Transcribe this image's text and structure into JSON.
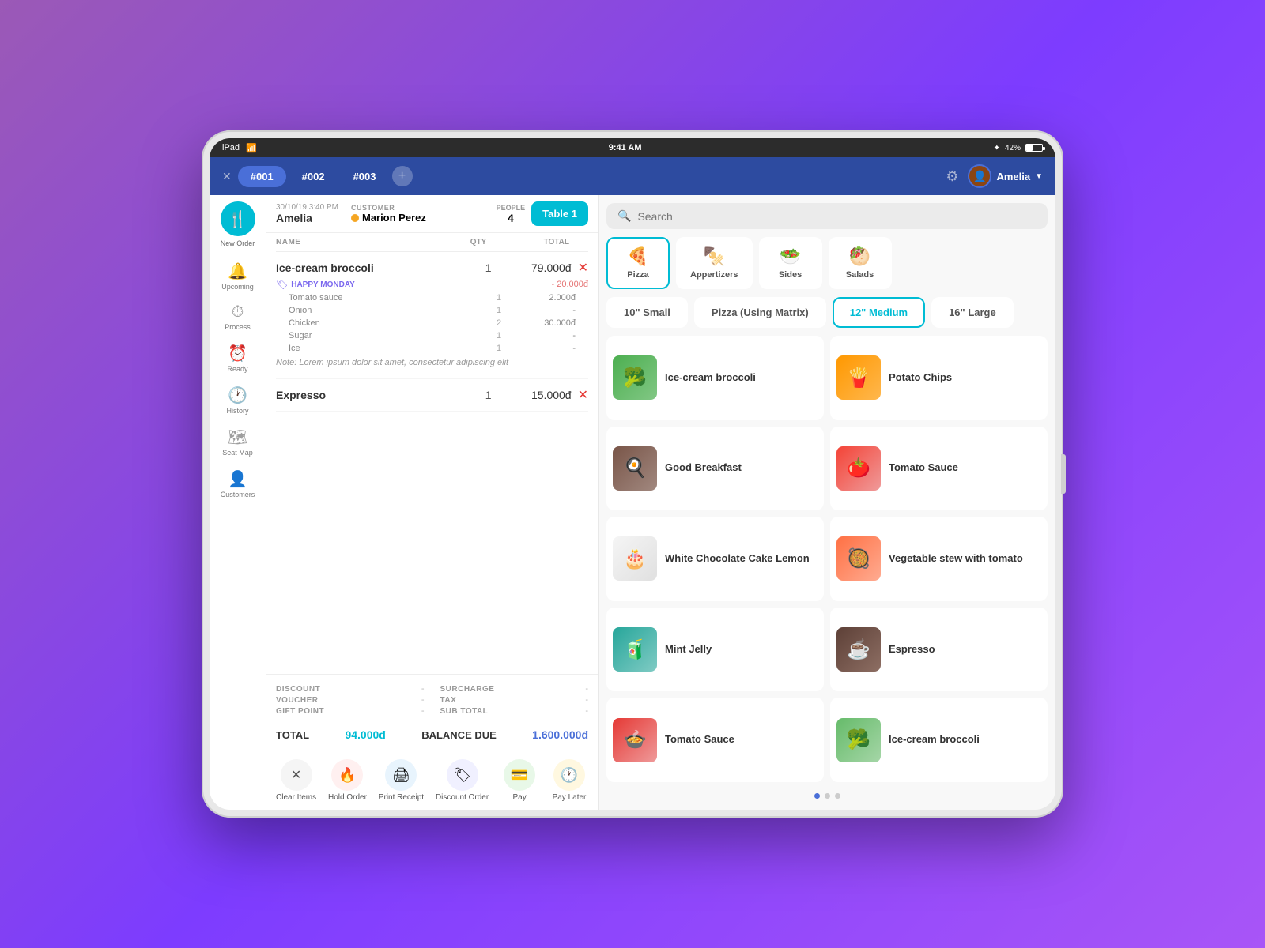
{
  "statusBar": {
    "device": "iPad",
    "wifi": "wifi",
    "time": "9:41 AM",
    "bluetooth": "42%",
    "battery": "42"
  },
  "navBar": {
    "tabs": [
      {
        "id": "001",
        "label": "#001",
        "active": true
      },
      {
        "id": "002",
        "label": "#002",
        "active": false
      },
      {
        "id": "003",
        "label": "#003",
        "active": false
      }
    ],
    "userName": "Amelia",
    "settingsIcon": "⚙"
  },
  "sidebar": {
    "logo": "🍴",
    "logoLabel": "New Order",
    "items": [
      {
        "id": "upcoming",
        "icon": "🔔",
        "label": "Upcoming"
      },
      {
        "id": "process",
        "icon": "⏱",
        "label": "Process"
      },
      {
        "id": "ready",
        "icon": "⏰",
        "label": "Ready"
      },
      {
        "id": "history",
        "icon": "🕐",
        "label": "History"
      },
      {
        "id": "seatmap",
        "icon": "🗺",
        "label": "Seat Map"
      },
      {
        "id": "customers",
        "icon": "👤",
        "label": "Customers"
      }
    ]
  },
  "order": {
    "datetime": "30/10/19 3:40 PM",
    "customerLabel": "CUSTOMER",
    "customerName": "Amelia",
    "clientName": "Marion Perez",
    "peopleLabel": "PEOPLE",
    "peopleCount": "4",
    "tableBtn": "Table 1",
    "columns": {
      "name": "NAME",
      "qty": "QTY",
      "total": "TOTAL"
    },
    "items": [
      {
        "name": "Ice-cream broccoli",
        "qty": "1",
        "price": "79.000đ",
        "modifierHeader": "HAPPY MONDAY",
        "modifiers": [
          {
            "name": "Tomato sauce",
            "qty": "1",
            "price": "2.000đ"
          },
          {
            "name": "Onion",
            "qty": "1",
            "price": "-"
          },
          {
            "name": "Chicken",
            "qty": "2",
            "price": "30.000đ"
          },
          {
            "name": "Sugar",
            "qty": "1",
            "price": "-"
          },
          {
            "name": "Ice",
            "qty": "1",
            "price": "-"
          }
        ],
        "modifierDiscount": "- 20.000đ",
        "note": "Note: Lorem ipsum dolor sit amet, consectetur adipiscing elit"
      },
      {
        "name": "Expresso",
        "qty": "1",
        "price": "15.000đ",
        "modifiers": []
      }
    ],
    "totals": {
      "discount": {
        "label": "DISCOUNT",
        "value": "-"
      },
      "surcharge": {
        "label": "SURCHARGE",
        "value": "-"
      },
      "voucher": {
        "label": "VOUCHER",
        "value": "-"
      },
      "tax": {
        "label": "TAX",
        "value": "-"
      },
      "giftPoint": {
        "label": "GIFT POINT",
        "value": "-"
      },
      "subTotal": {
        "label": "SUB TOTAL",
        "value": "-"
      }
    },
    "totalLabel": "TOTAL",
    "totalAmount": "94.000đ",
    "balanceLabel": "BALANCE DUE",
    "balanceAmount": "1.600.000đ"
  },
  "actions": [
    {
      "id": "clear",
      "icon": "✕",
      "label": "Clear Items",
      "colorClass": "icon-clear",
      "iconColor": "#555"
    },
    {
      "id": "hold",
      "icon": "🔥",
      "label": "Hold Order",
      "colorClass": "icon-hold",
      "iconColor": "#e53935"
    },
    {
      "id": "print",
      "icon": "🖨",
      "label": "Print Receipt",
      "colorClass": "icon-print",
      "iconColor": "#1976d2"
    },
    {
      "id": "discount",
      "icon": "🏷",
      "label": "Discount Order",
      "colorClass": "icon-discount",
      "iconColor": "#7b68ee"
    },
    {
      "id": "pay",
      "icon": "💳",
      "label": "Pay",
      "colorClass": "icon-pay",
      "iconColor": "#43a047"
    },
    {
      "id": "paylater",
      "icon": "🕐",
      "label": "Pay Later",
      "colorClass": "icon-paylater",
      "iconColor": "#f9a825"
    }
  ],
  "menu": {
    "searchPlaceholder": "Search",
    "categories": [
      {
        "id": "pizza",
        "icon": "🍕",
        "label": "Pizza",
        "active": true
      },
      {
        "id": "appetizers",
        "icon": "🍢",
        "label": "Appertizers",
        "active": false
      },
      {
        "id": "sides",
        "icon": "🥗",
        "label": "Sides",
        "active": false
      },
      {
        "id": "salads",
        "icon": "🥙",
        "label": "Salads",
        "active": false
      }
    ],
    "sizes": [
      {
        "id": "small",
        "label": "10\" Small",
        "active": false
      },
      {
        "id": "matrix",
        "label": "Pizza (Using Matrix)",
        "active": false
      },
      {
        "id": "medium",
        "label": "12\" Medium",
        "active": true
      },
      {
        "id": "large",
        "label": "16\" Large",
        "active": false
      }
    ],
    "items": [
      {
        "id": "icebroc",
        "name": "Ice-cream broccoli",
        "colorClass": "food-broccoli",
        "emoji": "🥦"
      },
      {
        "id": "chips",
        "name": "Potato Chips",
        "colorClass": "food-chips",
        "emoji": "🍟"
      },
      {
        "id": "breakfast",
        "name": "Good Breakfast",
        "colorClass": "food-breakfast",
        "emoji": "🍳"
      },
      {
        "id": "tomato",
        "name": "Tomato Sauce",
        "colorClass": "food-tomato",
        "emoji": "🍅"
      },
      {
        "id": "cake",
        "name": "White Chocolate Cake Lemon",
        "colorClass": "food-cake",
        "emoji": "🎂"
      },
      {
        "id": "stew",
        "name": "Vegetable stew with tomato",
        "colorClass": "food-stew",
        "emoji": "🥘"
      },
      {
        "id": "jelly",
        "name": "Mint Jelly",
        "colorClass": "food-jelly",
        "emoji": "🧃"
      },
      {
        "id": "espresso",
        "name": "Espresso",
        "colorClass": "food-espresso",
        "emoji": "☕"
      },
      {
        "id": "sauce2",
        "name": "Tomato Sauce",
        "colorClass": "food-sauce",
        "emoji": "🍲"
      },
      {
        "id": "icecream2",
        "name": "Ice-cream broccoli",
        "colorClass": "food-icecream2",
        "emoji": "🥦"
      }
    ],
    "pageDots": [
      {
        "active": true
      },
      {
        "active": false
      },
      {
        "active": false
      }
    ]
  }
}
